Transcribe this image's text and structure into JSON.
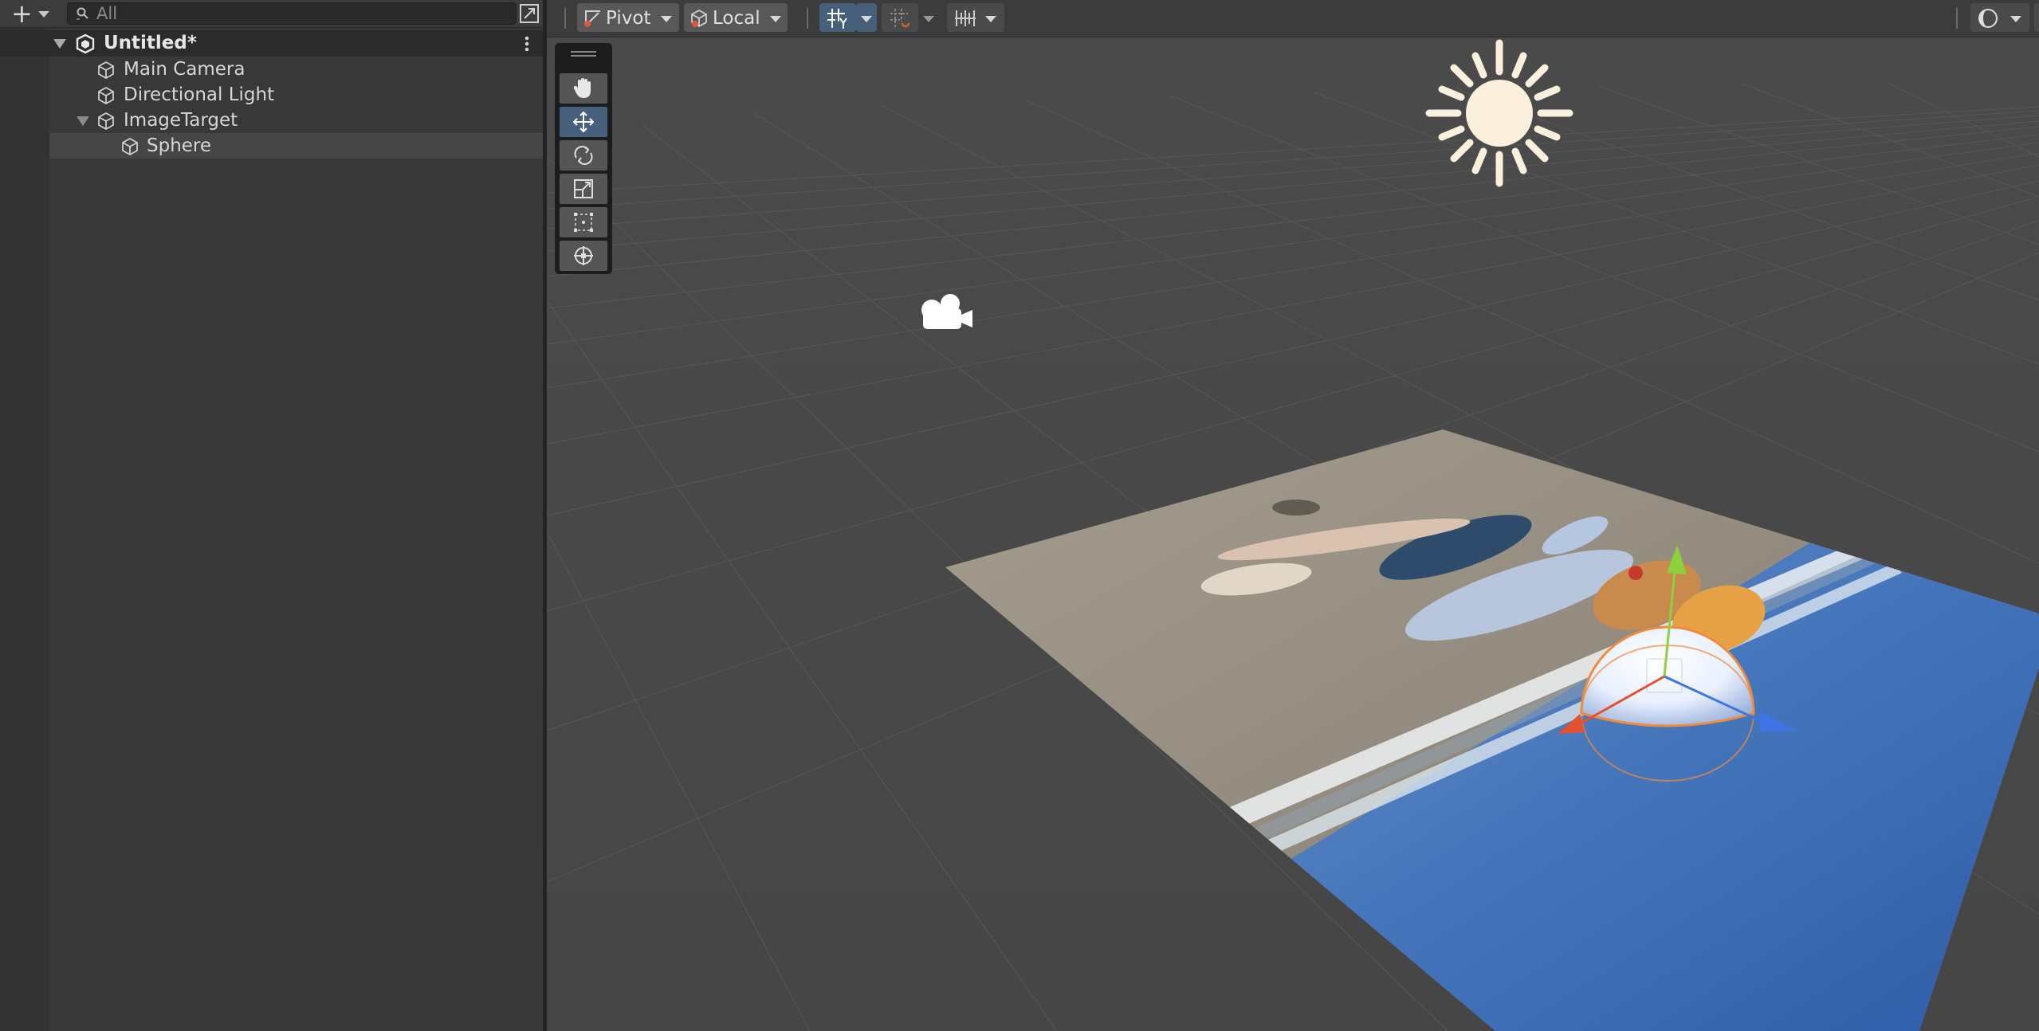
{
  "hierarchy": {
    "add_label": "+",
    "search_placeholder": "All",
    "scene_name": "Untitled*",
    "items": [
      {
        "label": "Main Camera"
      },
      {
        "label": "Directional Light"
      },
      {
        "label": "ImageTarget"
      },
      {
        "label": "Sphere"
      }
    ]
  },
  "scene_toolbar": {
    "pivot_label": "Pivot",
    "local_label": "Local"
  },
  "tools": [
    "hand-tool",
    "move-tool",
    "rotate-tool",
    "scale-tool",
    "rect-tool",
    "transform-tool"
  ],
  "active_tool": "move-tool",
  "colors": {
    "panel_bg": "#383838",
    "viewport_bg": "#464646",
    "selection": "#464646",
    "active_tool": "#46607c",
    "gizmo_x": "#e4512f",
    "gizmo_y": "#8ed13e",
    "gizmo_z": "#3f74e6",
    "selection_outline": "#f08a3c"
  }
}
